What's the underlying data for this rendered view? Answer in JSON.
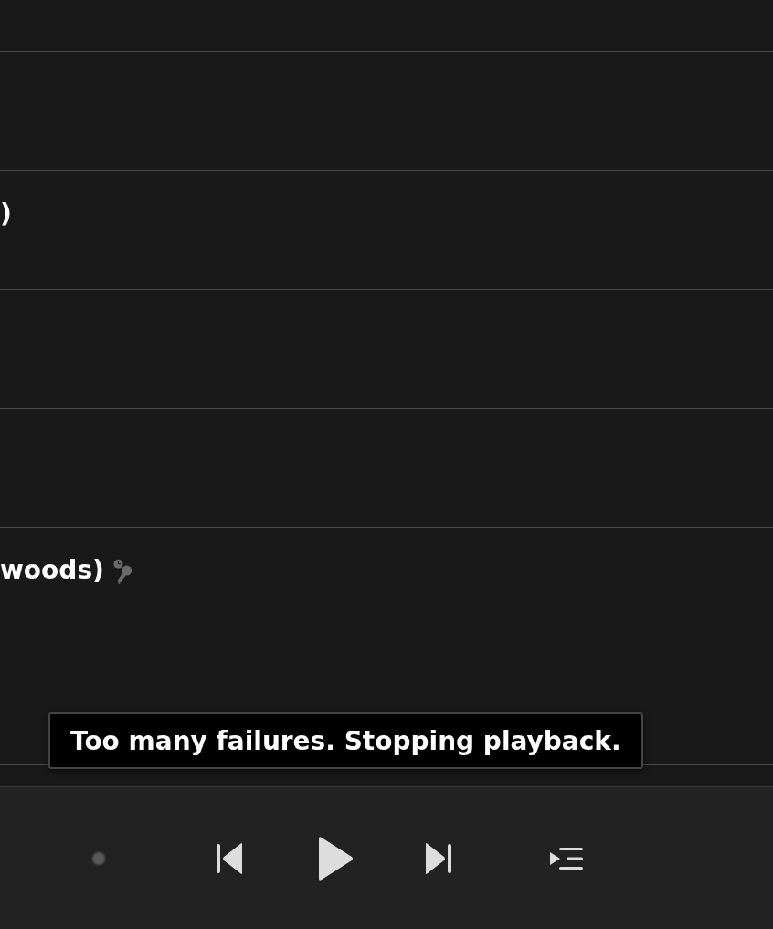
{
  "rows": [
    {
      "kind": "blank"
    },
    {
      "kind": "blank"
    },
    {
      "kind": "track",
      "title": ")",
      "badge": false
    },
    {
      "kind": "blank"
    },
    {
      "kind": "blank"
    },
    {
      "kind": "track",
      "title": "woods)",
      "badge": true
    },
    {
      "kind": "blank"
    },
    {
      "kind": "blank"
    }
  ],
  "toast": {
    "text": "Too many failures. Stopping playback."
  },
  "player": {
    "controls": [
      {
        "kind": "status"
      },
      {
        "kind": "previous"
      },
      {
        "kind": "play"
      },
      {
        "kind": "next"
      },
      {
        "kind": "queue"
      }
    ]
  }
}
